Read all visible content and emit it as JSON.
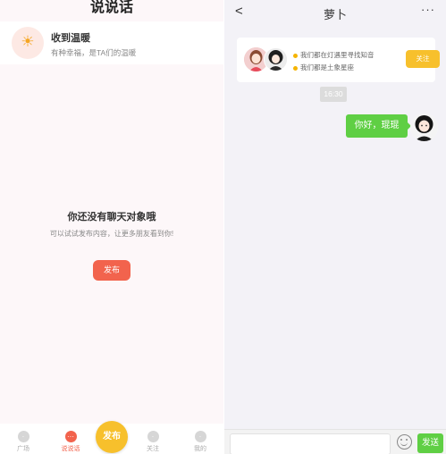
{
  "left_panel": {
    "title": "说说话",
    "notice": {
      "icon": "sun-icon",
      "title": "收到温暖",
      "subtitle": "有种幸福，是TA们的温暖"
    },
    "empty_state": {
      "title": "你还没有聊天对象哦",
      "subtitle": "可以试试发布内容，让更多朋友看到你!",
      "button_label": "发布"
    },
    "tabbar": {
      "fab_label": "发布",
      "tabs": [
        {
          "label": "广场",
          "active": false
        },
        {
          "label": "说说话",
          "active": true
        },
        {
          "label": "关注",
          "active": false
        },
        {
          "label": "我的",
          "active": false
        }
      ]
    },
    "accent_color": "#f2634d"
  },
  "right_panel": {
    "header": {
      "back_icon": "chevron-left-icon",
      "title": "萝卜",
      "more_icon": "ellipsis-icon",
      "back_glyph": "<",
      "more_glyph": "···"
    },
    "match_card": {
      "lines": [
        "我们都在灯遇里寻找知音",
        "我们都是土象星座"
      ],
      "button_label": "关注"
    },
    "messages": [
      {
        "type": "time",
        "text": "16:30"
      },
      {
        "type": "outgoing",
        "text": "你好，琨琨"
      }
    ],
    "input": {
      "value": "",
      "placeholder": "",
      "emoji_icon": "emoji-icon",
      "send_label": "发送"
    },
    "accent_color": "#5fcf44"
  }
}
